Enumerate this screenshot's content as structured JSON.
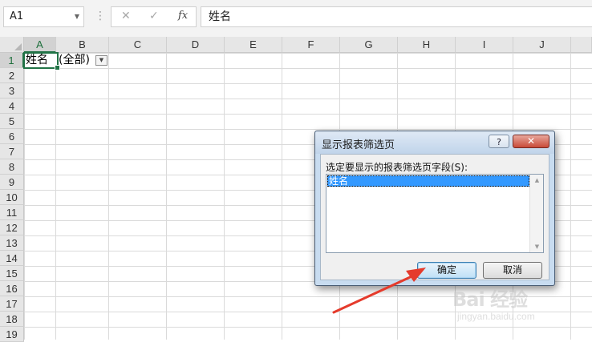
{
  "formula_bar": {
    "name_box": "A1",
    "cancel_icon": "✕",
    "enter_icon": "✓",
    "fx_label": "fx",
    "formula_value": "姓名"
  },
  "grid": {
    "columns": [
      "A",
      "B",
      "C",
      "D",
      "E",
      "F",
      "G",
      "H",
      "I",
      "J"
    ],
    "rows": [
      "1",
      "2",
      "3",
      "4",
      "5",
      "6",
      "7",
      "8",
      "9",
      "10",
      "11",
      "12",
      "13",
      "14",
      "15",
      "16",
      "17",
      "18",
      "19"
    ],
    "cells": {
      "A1": "姓名",
      "B1": "(全部)"
    }
  },
  "dialog": {
    "title": "显示报表筛选页",
    "help_label": "?",
    "close_label": "✕",
    "list_label": "选定要显示的报表筛选页字段(S):",
    "list_items": [
      "姓名"
    ],
    "ok_label": "确定",
    "cancel_label": "取消"
  },
  "annotation": {
    "arrow_color": "#e53b2c"
  },
  "watermark": {
    "brand": "Bai 经验",
    "url": "jingyan.baidu.com"
  },
  "colors": {
    "excel_green": "#217346",
    "selection_blue": "#3399ff"
  }
}
